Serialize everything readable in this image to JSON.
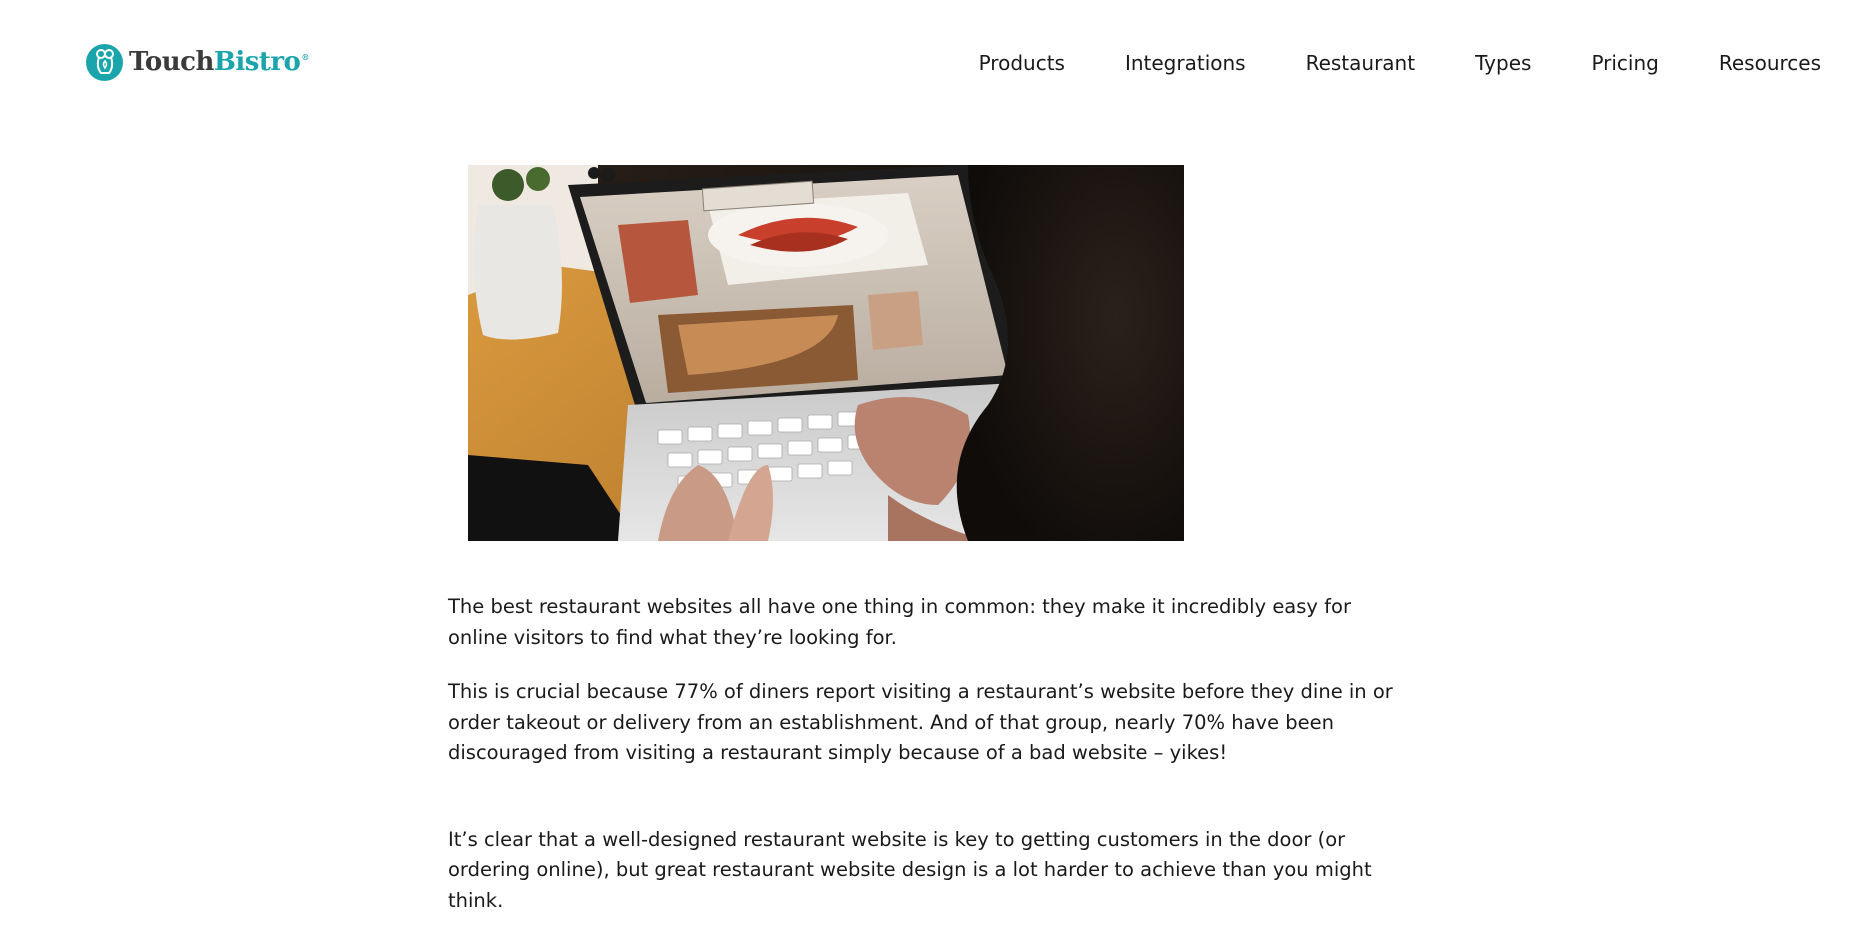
{
  "brand": {
    "name_part1": "Touch",
    "name_part2": "Bistro",
    "trademark": "®",
    "accent_color": "#1aa5ad"
  },
  "nav": {
    "items": [
      {
        "label": "Products"
      },
      {
        "label": "Integrations"
      },
      {
        "label": "Restaurant"
      },
      {
        "label": "Types"
      },
      {
        "label": "Pricing"
      },
      {
        "label": "Resources"
      }
    ]
  },
  "article": {
    "paragraphs": [
      "The best restaurant websites all have one thing in common: they make it incredibly easy for online visitors to find what they’re looking for.",
      "This is crucial because 77% of diners report visiting a restaurant’s website before they dine in or order takeout or delivery from an establishment. And of that group, nearly 70% have been discouraged from visiting a restaurant simply because of a bad website – yikes!",
      "It’s clear that a well-designed restaurant website is key to getting customers in the door (or ordering online), but great restaurant website design is a lot harder to achieve than you might think."
    ]
  }
}
